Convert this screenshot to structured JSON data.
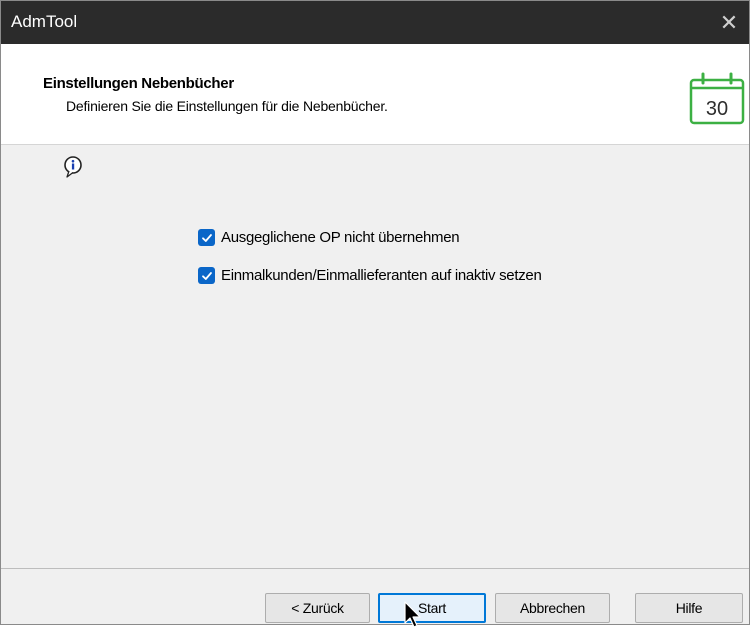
{
  "window": {
    "title": "AdmTool",
    "close_glyph": "✕"
  },
  "header": {
    "title": "Einstellungen Nebenbücher",
    "subtitle": "Definieren Sie die Einstellungen für die Nebenbücher.",
    "calendar_day": "30",
    "icon": "calendar-icon",
    "accent_color": "#3cb043"
  },
  "content": {
    "info_icon": "info-icon",
    "options": [
      {
        "label": "Ausgeglichene OP nicht übernehmen",
        "checked": true
      },
      {
        "label": "Einmalkunden/Einmallieferanten auf inaktiv setzen",
        "checked": true
      }
    ],
    "checkbox_color": "#0a66c8"
  },
  "footer": {
    "buttons": {
      "back": "< Zurück",
      "start": "Start",
      "cancel": "Abbrechen",
      "help": "Hilfe"
    }
  }
}
